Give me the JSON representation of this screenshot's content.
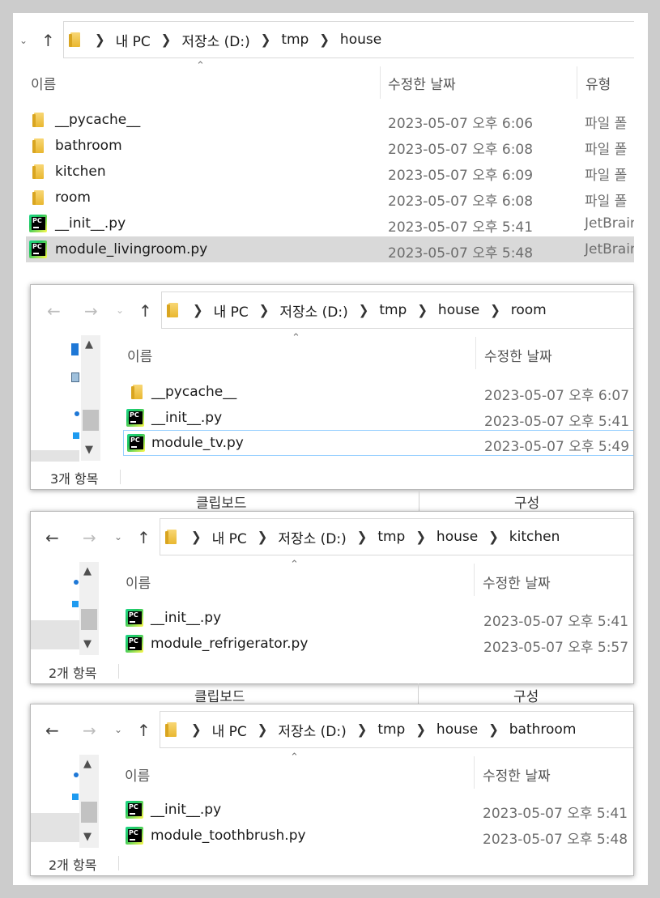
{
  "columns": {
    "name": "이름",
    "modified": "수정한 날짜",
    "type": "유형"
  },
  "breadcrumb": {
    "pc": "내 PC",
    "drive": "저장소 (D:)",
    "tmp": "tmp",
    "house": "house"
  },
  "ribbon": {
    "clipboard": "클립보드",
    "organize": "구성"
  },
  "window1": {
    "files": [
      {
        "name": "__pycache__",
        "date": "2023-05-07 오후 6:06",
        "type": "파일 폴",
        "icon": "folder-icon"
      },
      {
        "name": "bathroom",
        "date": "2023-05-07 오후 6:08",
        "type": "파일 폴",
        "icon": "folder-icon"
      },
      {
        "name": "kitchen",
        "date": "2023-05-07 오후 6:09",
        "type": "파일 폴",
        "icon": "folder-icon"
      },
      {
        "name": "room",
        "date": "2023-05-07 오후 6:08",
        "type": "파일 폴",
        "icon": "folder-icon"
      },
      {
        "name": "__init__.py",
        "date": "2023-05-07 오후 5:41",
        "type": "JetBrain",
        "icon": "pycharm-file-icon"
      },
      {
        "name": "module_livingroom.py",
        "date": "2023-05-07 오후 5:48",
        "type": "JetBrain",
        "icon": "pycharm-file-icon"
      }
    ]
  },
  "window2": {
    "folder": "room",
    "status": "3개 항목",
    "files": [
      {
        "name": "__pycache__",
        "date": "2023-05-07 오후 6:07"
      },
      {
        "name": "__init__.py",
        "date": "2023-05-07 오후 5:41"
      },
      {
        "name": "module_tv.py",
        "date": "2023-05-07 오후 5:49"
      }
    ]
  },
  "window3": {
    "folder": "kitchen",
    "status": "2개 항목",
    "files": [
      {
        "name": "__init__.py",
        "date": "2023-05-07 오후 5:41"
      },
      {
        "name": "module_refrigerator.py",
        "date": "2023-05-07 오후 5:57"
      }
    ]
  },
  "window4": {
    "folder": "bathroom",
    "status": "2개 항목",
    "files": [
      {
        "name": "__init__.py",
        "date": "2023-05-07 오후 5:41"
      },
      {
        "name": "module_toothbrush.py",
        "date": "2023-05-07 오후 5:48"
      }
    ]
  },
  "colors": {
    "selection": "#d9d9d9",
    "focus_border": "#99d1ff",
    "folder": "#f0c040"
  }
}
